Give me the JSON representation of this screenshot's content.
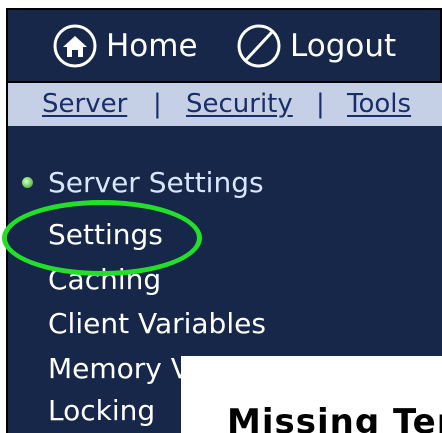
{
  "header": {
    "home_label": "Home",
    "logout_label": "Logout",
    "home_icon": "home-icon",
    "logout_icon": "logout-icon"
  },
  "nav": {
    "links": [
      "Server",
      "Security",
      "Tools"
    ],
    "separator": "|"
  },
  "menu": {
    "heading": "Server Settings",
    "items": [
      "Settings",
      "Caching",
      "Client Variables",
      "Memory Variables",
      "Locking"
    ]
  },
  "overlay": {
    "title": "Missing Ter"
  },
  "colors": {
    "header_bg": "#16274a",
    "nav_bg": "#c5d0e6",
    "nav_text": "#1a2d6b",
    "highlight": "#22e02a",
    "bullet": "#7edb6a"
  }
}
